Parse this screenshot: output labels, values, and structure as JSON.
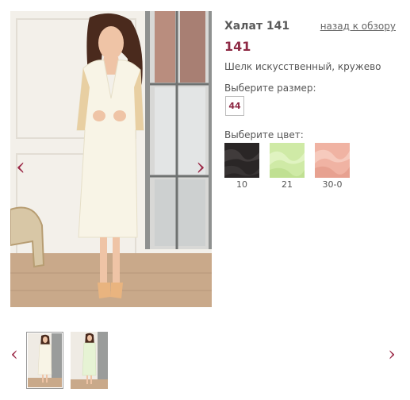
{
  "product": {
    "title": "Халат 141",
    "price": "141",
    "material": "Шелк искусственный, кружево",
    "back_link": "назад к обзору"
  },
  "gallery": {
    "main_image": "photo-model-ivory-satin-robe",
    "prev_icon": "‹",
    "next_icon": "›",
    "thumbnails": [
      {
        "image": "thumb-ivory-robe",
        "selected": true
      },
      {
        "image": "thumb-green-robe",
        "selected": false
      }
    ]
  },
  "size": {
    "label": "Выберите размер:",
    "options": [
      "44"
    ]
  },
  "color": {
    "label": "Выберите цвет:",
    "options": [
      {
        "code": "10",
        "hex": "#2a2626"
      },
      {
        "code": "21",
        "hex": "#cfeaa6"
      },
      {
        "code": "30-0",
        "hex": "#f0b3a3"
      }
    ]
  },
  "accent": "#8e2a45"
}
